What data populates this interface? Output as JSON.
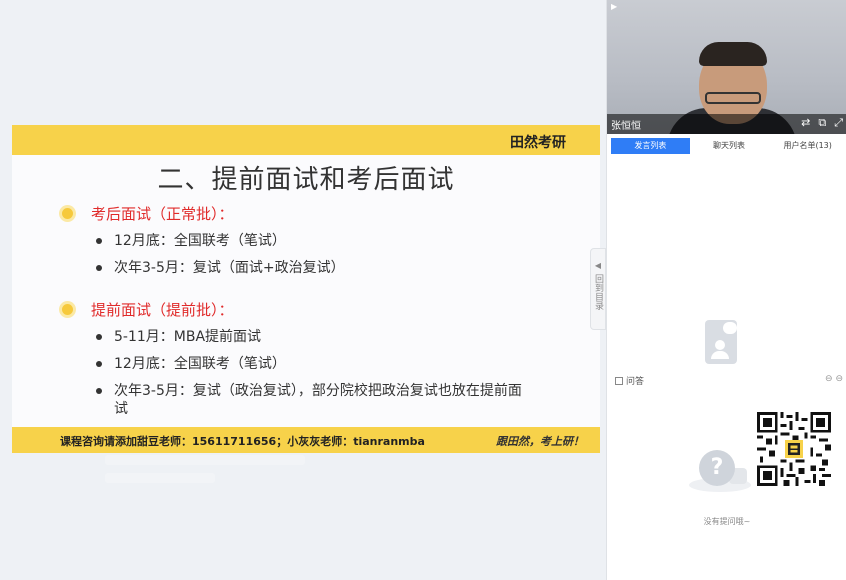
{
  "slide": {
    "brand": "田然考研",
    "title": "二、提前面试和考后面试",
    "sections": [
      {
        "heading": "考后面试（正常批）：",
        "items": [
          "12月底：全国联考（笔试）",
          "次年3-5月：复试（面试+政治复试）"
        ]
      },
      {
        "heading": "提前面试（提前批）：",
        "items": [
          "5-11月：MBA提前面试",
          "12月底：全国联考（笔试）",
          "次年3-5月：复试（政治复试），部分院校把政治复试也放在提前面试"
        ]
      }
    ],
    "footer_contact": "课程咨询请添加甜豆老师：15611711656；小灰灰老师：tianranmba",
    "footer_slogan": "跟田然，考上研！",
    "colors": {
      "accent": "#f7d24a",
      "heading_red": "#e02b2b"
    }
  },
  "side_tab": {
    "label": "回到目录"
  },
  "video": {
    "presenter_name": "张恒恒",
    "controls": [
      "switch-icon",
      "popout-icon",
      "fullscreen-icon"
    ]
  },
  "tabs": [
    {
      "label": "发言列表",
      "active": true
    },
    {
      "label": "聊天列表",
      "active": false
    },
    {
      "label": "用户名单(13)",
      "active": false
    }
  ],
  "qa": {
    "label": "问答",
    "empty_text": "没有提问哦~"
  }
}
